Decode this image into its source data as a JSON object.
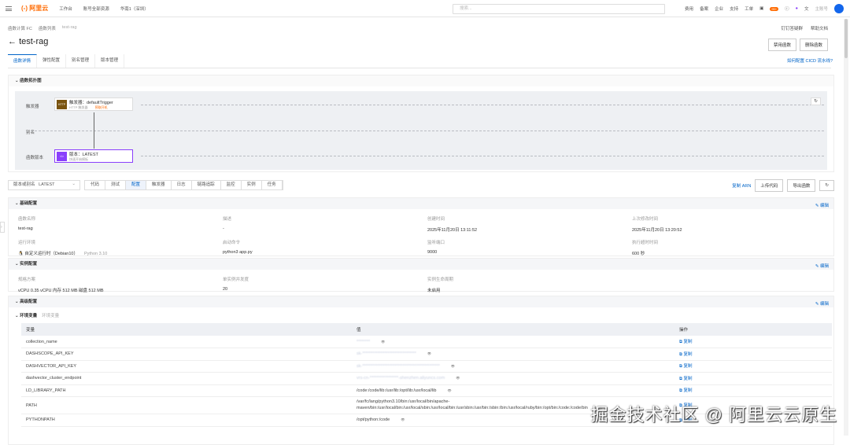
{
  "topbar": {
    "logo": "(-) 阿里云",
    "workbench": "工作台",
    "resources": "账号全部资源",
    "region": "华南1（深圳）",
    "search_placeholder": "搜索...",
    "nav": [
      "费用",
      "备案",
      "企业",
      "支持",
      "工单"
    ],
    "badge": "99+",
    "account": "主账号"
  },
  "breadcrumb": [
    "函数计算 FC",
    "函数列表",
    "test-rag"
  ],
  "header_links": [
    "钉钉答疑群",
    "帮助文档"
  ],
  "title": "test-rag",
  "actions": {
    "disable": "禁用函数",
    "delete": "删除函数"
  },
  "tabs": [
    "函数详情",
    "弹性配置",
    "别名管理",
    "版本管理"
  ],
  "cicd_link": "如何配置 CICD 流水线?",
  "topology": {
    "title": "函数拓扑图",
    "lanes": [
      "触发器",
      "别名",
      "函数版本"
    ],
    "trigger": {
      "name": "触发器：defaultTrigger",
      "type": "HTTP 触发器",
      "status": "预取开机",
      "icon": "HTTP"
    },
    "version": {
      "name": "版本：LATEST",
      "sub": "快速开始模板"
    }
  },
  "toolbar": {
    "select_label": "版本或别名",
    "select_value": "LATEST",
    "segments": [
      "代码",
      "测试",
      "配置",
      "触发器",
      "日志",
      "链路追踪",
      "监控",
      "实例",
      "任务"
    ],
    "active": "配置",
    "copy_arn": "复制 ARN",
    "upload": "上传代码",
    "export": "导出函数"
  },
  "basic": {
    "title": "基础配置",
    "edit": "编辑",
    "fields": [
      {
        "label": "函数名称",
        "value": "test-rag"
      },
      {
        "label": "描述",
        "value": "-"
      },
      {
        "label": "创建时间",
        "value": "2025年11月20日 13:11:52"
      },
      {
        "label": "上次修改时间",
        "value": "2025年11月20日 13:20:52"
      },
      {
        "label": "运行环境",
        "value": "自定义运行时（Debian10）",
        "extra": "Python 3.10"
      },
      {
        "label": "启动命令",
        "value": "python3 app.py"
      },
      {
        "label": "监听端口",
        "value": "9000"
      },
      {
        "label": "执行超时时间",
        "value": "600 秒"
      }
    ]
  },
  "instance": {
    "title": "实例配置",
    "edit": "编辑",
    "fields": [
      {
        "label": "规格方案",
        "value": "vCPU 0.35 vCPU   内存 512 MB   磁盘 512 MB"
      },
      {
        "label": "单实例并发度",
        "value": "20"
      },
      {
        "label": "实例生命周期",
        "value": "未启用"
      }
    ]
  },
  "advanced": {
    "title": "高级配置",
    "edit": "编辑",
    "env_title": "环境变量",
    "env_sub": "环境变量",
    "columns": [
      "变量",
      "值",
      "操作"
    ],
    "copy": "复制",
    "rows": [
      {
        "key": "collection_name",
        "value": "********"
      },
      {
        "key": "DASHSCOPE_API_KEY",
        "value": "sk-********************************"
      },
      {
        "key": "DASHVECTOR_API_KEY",
        "value": "sk-**********************************************"
      },
      {
        "key": "dashvector_cluster_endpoint",
        "value": "vrs-cn-*****************-shenzhen.aliyuncs.com"
      },
      {
        "key": "LD_LIBRARY_PATH",
        "value": "/code:/code/lib:/usr/lib:/opt/lib:/usr/local/lib"
      },
      {
        "key": "PATH",
        "value": "/var/fc/lang/python3.10/bin:/usr/local/bin/apache-maven/bin:/usr/local/bin:/usr/local/sbin:/usr/local/bin:/usr/sbin:/usr/bin:/sbin:/bin:/usr/local/ruby/bin:/opt/bin:/code:/code/bin"
      },
      {
        "key": "PYTHONPATH",
        "value": "/opt/python:/code"
      }
    ]
  },
  "watermark": "掘金技术社区 @ 阿里云云原生"
}
